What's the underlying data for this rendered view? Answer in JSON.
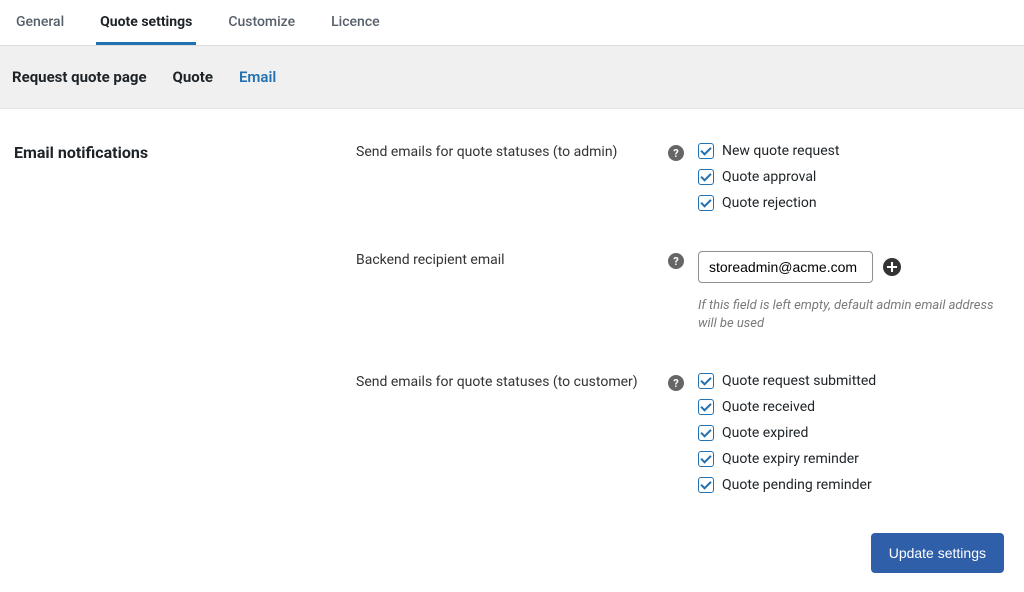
{
  "tabs": {
    "general": "General",
    "quote_settings": "Quote settings",
    "customize": "Customize",
    "licence": "Licence"
  },
  "subnav": {
    "request_page": "Request quote page",
    "quote": "Quote",
    "email": "Email"
  },
  "section": {
    "title": "Email notifications"
  },
  "admin_statuses": {
    "label": "Send emails for quote statuses (to admin)",
    "items": {
      "new_request": "New quote request",
      "approval": "Quote approval",
      "rejection": "Quote rejection"
    }
  },
  "recipient": {
    "label": "Backend recipient email",
    "value": "storeadmin@acme.com",
    "hint": "If this field is left empty, default admin email address will be used"
  },
  "customer_statuses": {
    "label": "Send emails for quote statuses (to customer)",
    "items": {
      "submitted": "Quote request submitted",
      "received": "Quote received",
      "expired": "Quote expired",
      "expiry_reminder": "Quote expiry reminder",
      "pending_reminder": "Quote pending reminder"
    }
  },
  "buttons": {
    "save": "Update settings"
  }
}
